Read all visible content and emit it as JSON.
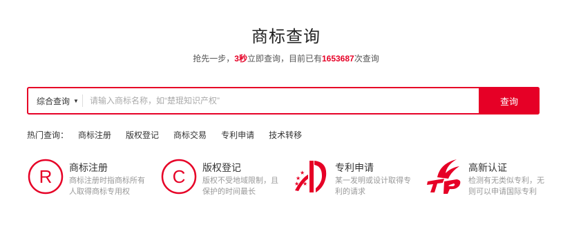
{
  "page": {
    "title": "商标查询"
  },
  "subtitle": {
    "pre": "抢先一步，",
    "seconds": "3秒",
    "mid": "立即查询，目前已有",
    "count": "1653687",
    "post": "次查询"
  },
  "search": {
    "type_label": "综合查询",
    "placeholder": "请输入商标名称，如“楚琨知识产权”",
    "button_label": "查询"
  },
  "hot": {
    "label": "热门查询：",
    "links": [
      "商标注册",
      "版权登记",
      "商标交易",
      "专利申请",
      "技术转移"
    ]
  },
  "services": [
    {
      "title": "商标注册",
      "desc": "商标注册时指商标所有人取得商标专用权",
      "icon": "registered-icon"
    },
    {
      "title": "版权登记",
      "desc": "版权不受地域限制，且保护的时间最长",
      "icon": "copyright-icon"
    },
    {
      "title": "专利申请",
      "desc": "某一发明或设计取得专利的请求",
      "icon": "patent-icon"
    },
    {
      "title": "高新认证",
      "desc": "检测有无类似专利，无则可以申请国际专利",
      "icon": "hightech-icon"
    }
  ],
  "colors": {
    "accent": "#e60026"
  }
}
